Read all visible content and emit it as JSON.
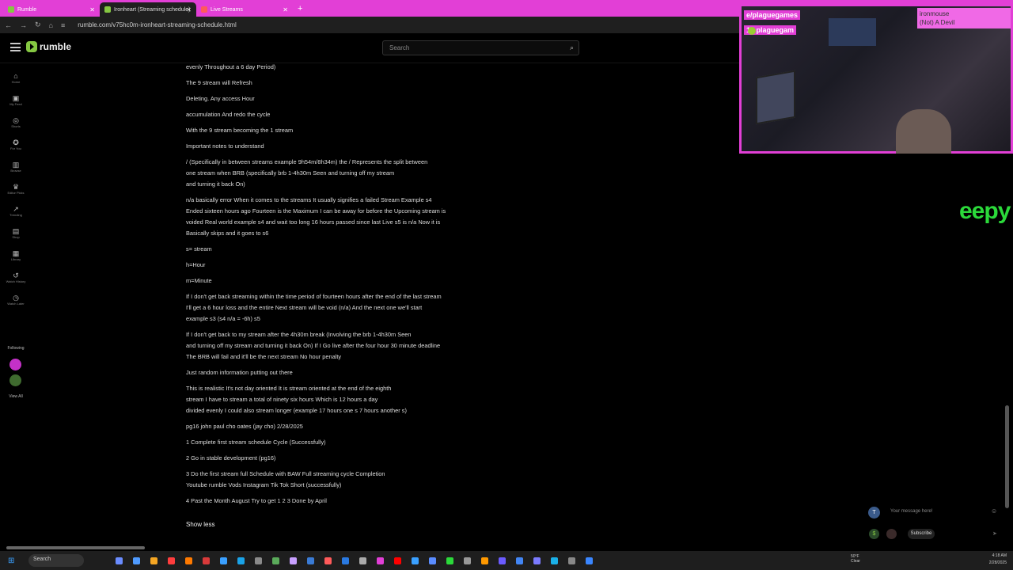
{
  "tabs": [
    {
      "label": "Rumble",
      "active": false,
      "color": "#85c742"
    },
    {
      "label": "Ironheart (Streaming schedule)",
      "active": true,
      "color": "#85c742"
    },
    {
      "label": "Live Streams",
      "active": false,
      "color": "#ff5a5a"
    }
  ],
  "address": {
    "url": "rumble.com/v75hc0m-ironheart-streaming-schedule.html"
  },
  "header": {
    "logo": "rumble",
    "search_placeholder": "Search"
  },
  "sidebar": {
    "items": [
      {
        "label": "Home",
        "icon": "home-icon",
        "glyph": "⌂"
      },
      {
        "label": "My Feed",
        "icon": "feed-icon",
        "glyph": "▣"
      },
      {
        "label": "Shorts",
        "icon": "shorts-icon",
        "glyph": "◎"
      },
      {
        "label": "For You",
        "icon": "foryou-icon",
        "glyph": "✪"
      },
      {
        "label": "Browse",
        "icon": "browse-icon",
        "glyph": "▥"
      },
      {
        "label": "Editor Picks",
        "icon": "editor-icon",
        "glyph": "♛"
      },
      {
        "label": "Trending",
        "icon": "trending-icon",
        "glyph": "↗"
      },
      {
        "label": "Shop",
        "icon": "shop-icon",
        "glyph": "▤"
      },
      {
        "label": "Library",
        "icon": "library-icon",
        "glyph": "▦"
      },
      {
        "label": "Watch History",
        "icon": "history-icon",
        "glyph": "↺"
      },
      {
        "label": "Watch Later",
        "icon": "later-icon",
        "glyph": "◷"
      }
    ],
    "following_label": "Following",
    "view_all": "View All"
  },
  "content": {
    "lines": [
      "evenly Throughout a 6 day Period)",
      "The 9 stream will Refresh",
      "Deleting. Any access Hour",
      "accumulation And redo the cycle",
      "With the 9 stream becoming the 1 stream",
      "Important notes to understand",
      "/ (Specifically in between streams example 9h54m/8h34m) the / Represents the split between",
      "one stream when BRB (specifically brb 1-4h30m Seen and turning off my stream",
      "and turning it back On)",
      "n/a basically error When it comes to the streams It usually signifies a failed Stream Example s4",
      "Ended sixteen hours ago Fourteen is the Maximum I can be away for before the Upcoming stream is",
      "voided Real world example s4 and wait too long 16 hours passed since last Live s5 is n/a Now it is",
      "Basically skips and it goes to s6",
      "s= stream",
      "h=Hour",
      "m=Minute",
      "If I don't get back streaming within the time period of fourteen hours after the end of the last stream",
      "I'll get a 6 hour loss and the entire Next stream will be void (n/a) And the next one we'll start",
      "example s3 (s4 n/a = -6h) s5",
      "If I don't get back to my stream after the 4h30m break (Involving the brb 1-4h30m Seen",
      "and turning off my stream and turning it back On) If I Go live after the four hour 30 minute deadline",
      "The BRB will fail and it'll be the next stream No hour penalty",
      "Just random information putting out there",
      "This is realistic It's not day oriented It is stream oriented at the end of the eighth",
      "stream I have to stream a total of ninety six hours Which is 12 hours a day",
      "divided evenly I could also stream longer (example 17 hours one s 7 hours another s)",
      "pg16 john paul cho oates (jay cho) 2/28/2025",
      "1 Complete first stream schedule Cycle (Successfully)",
      "2 Go in stable development (pg16)",
      "3 Do the first stream full Schedule with BAW Full streaming cycle Completion",
      "Youtube rumble Vods Instagram Tik Tok Short (successfully)",
      "4 Past the Month August Try to get 1 2 3 Done by April"
    ],
    "show_less": "Show less"
  },
  "overlay": {
    "handle1": "e/plaguegames",
    "handle2": "16 plaguegam",
    "name_line1": "ironmouse",
    "name_line2": "(Not) A Devil"
  },
  "eepy_text": "eepy",
  "chat": {
    "avatar_letter": "T",
    "placeholder": "Your message here!",
    "subscribe": "Subscribe"
  },
  "taskbar": {
    "search": "Search",
    "time": "4:18 AM",
    "date": "2/28/2025",
    "weather_temp": "50°F",
    "weather_desc": "Clear"
  },
  "colors": {
    "accent": "#e23fd6",
    "brand": "#85c742",
    "eepy": "#2bd93a"
  }
}
